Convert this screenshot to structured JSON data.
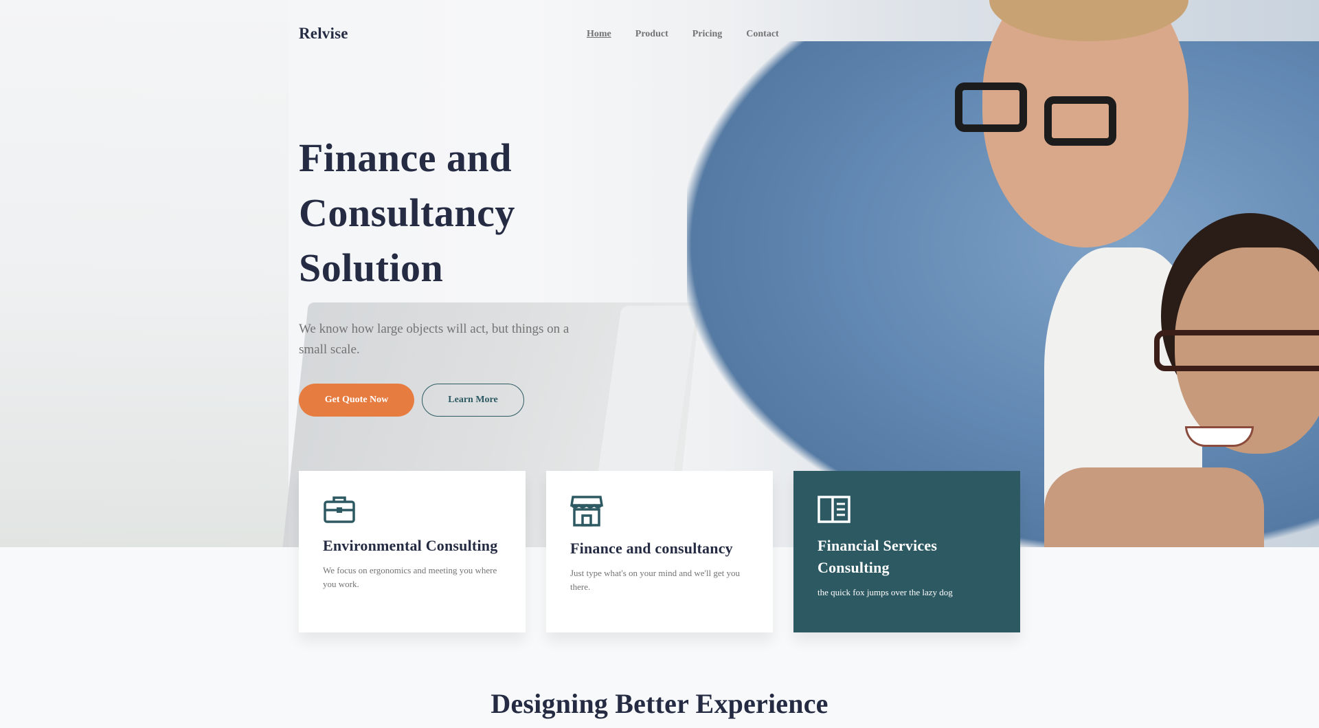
{
  "brand": "Relvise",
  "nav": [
    {
      "label": "Home"
    },
    {
      "label": "Product"
    },
    {
      "label": "Pricing"
    },
    {
      "label": "Contact"
    }
  ],
  "hero": {
    "title_line1": "Finance and",
    "title_line2": "Consultancy",
    "title_line3": "Solution",
    "subtitle": "We know how large objects will act, but things on a small scale.",
    "primary_button": "Get Quote Now",
    "secondary_button": "Learn More"
  },
  "cards": [
    {
      "title": "Environmental Consulting",
      "text": "We focus on ergonomics and meeting you where you work.",
      "icon": "briefcase-icon"
    },
    {
      "title": "Finance and consultancy",
      "text": "Just type what's on your mind and we'll get you there.",
      "icon": "storefront-icon"
    },
    {
      "title": "Financial Services Consulting",
      "text": "the quick fox jumps over the lazy dog",
      "icon": "book-open-icon"
    }
  ],
  "section_title": "Designing Better Experience",
  "colors": {
    "accent": "#e77c40",
    "dark_teal": "#2d5962",
    "heading": "#252b42",
    "muted": "#737373"
  }
}
